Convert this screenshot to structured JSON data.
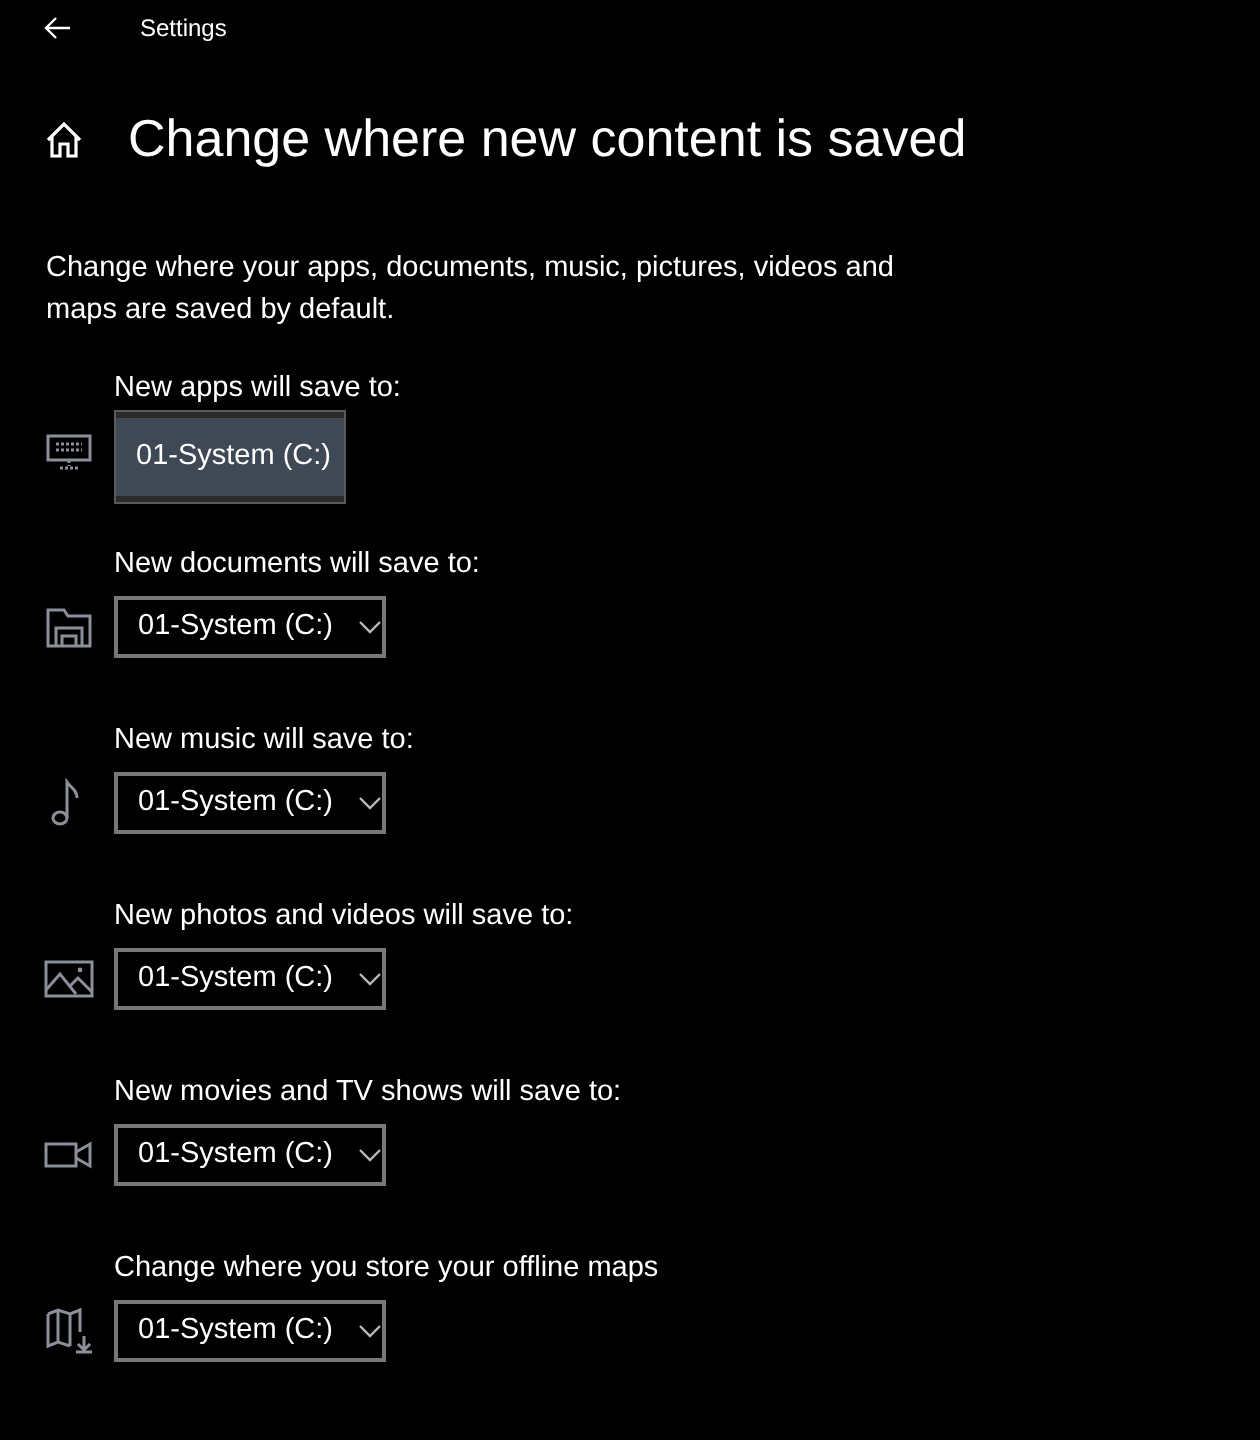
{
  "window": {
    "title": "Settings"
  },
  "page_title": "Change where new content is saved",
  "description": "Change where your apps, documents, music, pictures, videos and maps are saved by default.",
  "locations": [
    {
      "label": "New apps will save to:",
      "kind": "keyboard",
      "value": "01-System (C:)",
      "expanded": true
    },
    {
      "label": "New documents will save to:",
      "kind": "folder",
      "value": "01-System (C:)",
      "expanded": false
    },
    {
      "label": "New music will save to:",
      "kind": "music",
      "value": "01-System (C:)",
      "expanded": false
    },
    {
      "label": "New photos and videos will save to:",
      "kind": "photo",
      "value": "01-System (C:)",
      "expanded": false
    },
    {
      "label": "New movies and TV shows will save to:",
      "kind": "video",
      "value": "01-System (C:)",
      "expanded": false
    },
    {
      "label": "Change where you store your offline maps",
      "kind": "map",
      "value": "01-System (C:)",
      "expanded": false
    }
  ]
}
